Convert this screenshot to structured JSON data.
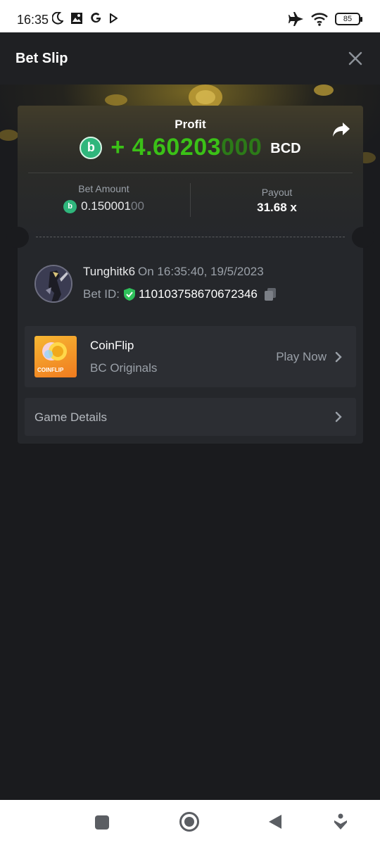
{
  "status_bar": {
    "time": "16:35",
    "battery": "85",
    "left_icons": [
      "moon-icon",
      "photo-icon",
      "google-icon",
      "play-icon"
    ],
    "right_icons": [
      "airplane-icon",
      "wifi-icon",
      "battery-icon"
    ]
  },
  "header": {
    "title": "Bet Slip",
    "close_icon": "close-icon"
  },
  "slip": {
    "profit_label": "Profit",
    "profit_sign": "+ ",
    "profit_main": "4.60203",
    "profit_trailing": "000",
    "currency": "BCD",
    "coin_glyph": "b",
    "bet_amount_label": "Bet Amount",
    "bet_amount_main": "0.150001",
    "bet_amount_trailing": "00",
    "payout_label": "Payout",
    "payout_value": "31.68 x"
  },
  "user": {
    "username": "Tunghitk6",
    "timestamp": "On 16:35:40, 19/5/2023",
    "bet_id_label": "Bet ID:",
    "bet_id": "110103758670672346"
  },
  "game": {
    "name": "CoinFlip",
    "provider": "BC Originals",
    "thumb_label": "COINFLIP",
    "play_label": "Play Now"
  },
  "details": {
    "label": "Game Details"
  },
  "colors": {
    "profit_green": "#3bc117",
    "coin_green": "#2fb67c",
    "background": "#1a1b1e",
    "card": "#25272b"
  }
}
